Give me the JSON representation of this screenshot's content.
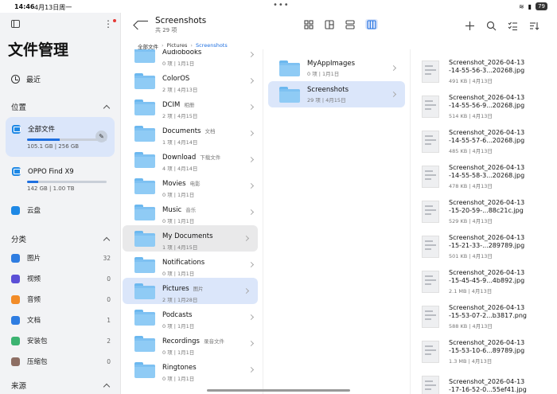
{
  "status": {
    "time": "14:46",
    "date": "4月13日周一",
    "battery": "79"
  },
  "sidebar": {
    "app_title": "文件管理",
    "recent_label": "最近",
    "location_header": "位置",
    "storage": [
      {
        "label": "全部文件",
        "usage": "105.1 GB | 256 GB",
        "fraction": 0.41,
        "active": true
      },
      {
        "label": "OPPO Find X9",
        "usage": "142 GB | 1.00 TB",
        "fraction": 0.14,
        "active": false
      }
    ],
    "cloud_label": "云盘",
    "category_header": "分类",
    "categories": [
      {
        "label": "图片",
        "count": "32",
        "color": "#2f7de1"
      },
      {
        "label": "视频",
        "count": "0",
        "color": "#5b4fd6"
      },
      {
        "label": "音频",
        "count": "0",
        "color": "#f28c28"
      },
      {
        "label": "文档",
        "count": "1",
        "color": "#2f7de1"
      },
      {
        "label": "安装包",
        "count": "2",
        "color": "#3cb371"
      },
      {
        "label": "压缩包",
        "count": "0",
        "color": "#8d6e63"
      }
    ],
    "bottom_header": "来源"
  },
  "toolbar": {
    "title": "Screenshots",
    "subtitle": "共 29 项"
  },
  "breadcrumb": [
    "全部文件",
    "Pictures",
    "Screenshots"
  ],
  "col1": [
    {
      "name": "Audiobooks",
      "tag": "",
      "meta": "0 项 | 1月1日",
      "state": ""
    },
    {
      "name": "ColorOS",
      "tag": "",
      "meta": "2 项 | 4月13日",
      "state": ""
    },
    {
      "name": "DCIM",
      "tag": "相册",
      "meta": "2 项 | 4月15日",
      "state": ""
    },
    {
      "name": "Documents",
      "tag": "文档",
      "meta": "1 项 | 4月14日",
      "state": ""
    },
    {
      "name": "Download",
      "tag": "下载文件",
      "meta": "4 项 | 4月14日",
      "state": ""
    },
    {
      "name": "Movies",
      "tag": "电影",
      "meta": "0 项 | 1月1日",
      "state": ""
    },
    {
      "name": "Music",
      "tag": "音乐",
      "meta": "0 项 | 1月1日",
      "state": ""
    },
    {
      "name": "My Documents",
      "tag": "",
      "meta": "1 项 | 4月15日",
      "state": "grey"
    },
    {
      "name": "Notifications",
      "tag": "",
      "meta": "0 项 | 1月1日",
      "state": ""
    },
    {
      "name": "Pictures",
      "tag": "图片",
      "meta": "2 项 | 1月28日",
      "state": "blue"
    },
    {
      "name": "Podcasts",
      "tag": "",
      "meta": "0 项 | 1月1日",
      "state": ""
    },
    {
      "name": "Recordings",
      "tag": "录音文件",
      "meta": "0 项 | 1月1日",
      "state": ""
    },
    {
      "name": "Ringtones",
      "tag": "",
      "meta": "0 项 | 1月1日",
      "state": ""
    }
  ],
  "col2": [
    {
      "name": "MyAppImages",
      "meta": "0 项 | 1月1日",
      "state": ""
    },
    {
      "name": "Screenshots",
      "meta": "29 项 | 4月15日",
      "state": "blue"
    }
  ],
  "files": [
    {
      "name1": "Screenshot_2026-04-13",
      "name2": "-14-55-56-3...20268.jpg",
      "meta": "491 KB | 4月13日"
    },
    {
      "name1": "Screenshot_2026-04-13",
      "name2": "-14-55-56-9...20268.jpg",
      "meta": "514 KB | 4月13日"
    },
    {
      "name1": "Screenshot_2026-04-13",
      "name2": "-14-55-57-6...20268.jpg",
      "meta": "485 KB | 4月13日"
    },
    {
      "name1": "Screenshot_2026-04-13",
      "name2": "-14-55-58-3...20268.jpg",
      "meta": "478 KB | 4月13日"
    },
    {
      "name1": "Screenshot_2026-04-13",
      "name2": "-15-20-59-...88c21c.jpg",
      "meta": "529 KB | 4月13日"
    },
    {
      "name1": "Screenshot_2026-04-13",
      "name2": "-15-21-33-...289789.jpg",
      "meta": "501 KB | 4月13日"
    },
    {
      "name1": "Screenshot_2026-04-13",
      "name2": "-15-45-45-9...4b892.jpg",
      "meta": "2.1 MB | 4月13日"
    },
    {
      "name1": "Screenshot_2026-04-13",
      "name2": "-15-53-07-2...b3817.png",
      "meta": "588 KB | 4月13日"
    },
    {
      "name1": "Screenshot_2026-04-13",
      "name2": "-15-53-10-6...89789.jpg",
      "meta": "1.3 MB | 4月13日"
    },
    {
      "name1": "Screenshot_2026-04-13",
      "name2": "-17-16-52-0...55ef41.jpg",
      "meta": ""
    }
  ]
}
